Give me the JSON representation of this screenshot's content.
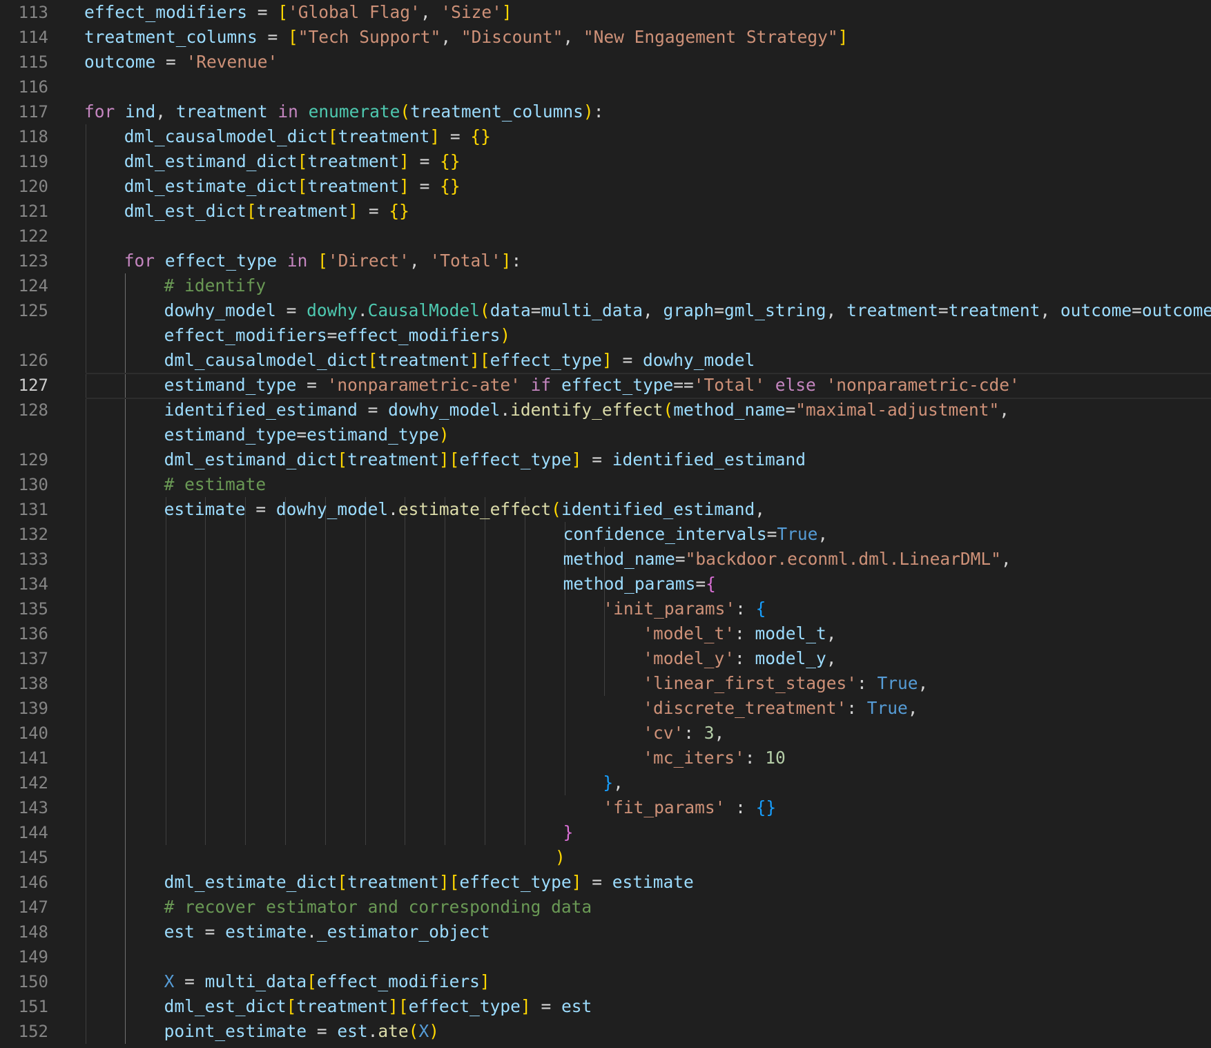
{
  "editor": {
    "language": "python",
    "theme": {
      "background": "#1f1f1f",
      "line_number": "#858585",
      "line_number_active": "#cccccc",
      "variable": "#9cdcfe",
      "string": "#ce9178",
      "keyword": "#c586c0",
      "function": "#dcdcaa",
      "class": "#4ec9b0",
      "constant": "#569cd6",
      "number": "#b5cea8",
      "comment": "#6a9955",
      "bracket_level_1": "#ffd700",
      "bracket_level_2": "#da70d6",
      "bracket_level_3": "#179fff"
    },
    "current_line": 127,
    "lines": [
      {
        "n": "113",
        "indent": 0,
        "tokens": [
          [
            "v",
            "effect_modifiers"
          ],
          [
            "o",
            " = "
          ],
          [
            "b1",
            "["
          ],
          [
            "s",
            "'Global Flag'"
          ],
          [
            "o",
            ", "
          ],
          [
            "s",
            "'Size'"
          ],
          [
            "b1",
            "]"
          ]
        ]
      },
      {
        "n": "114",
        "indent": 0,
        "tokens": [
          [
            "v",
            "treatment_columns"
          ],
          [
            "o",
            " = "
          ],
          [
            "b1",
            "["
          ],
          [
            "s",
            "\"Tech Support\""
          ],
          [
            "o",
            ", "
          ],
          [
            "s",
            "\"Discount\""
          ],
          [
            "o",
            ", "
          ],
          [
            "s",
            "\"New Engagement Strategy\""
          ],
          [
            "b1",
            "]"
          ]
        ]
      },
      {
        "n": "115",
        "indent": 0,
        "tokens": [
          [
            "v",
            "outcome"
          ],
          [
            "o",
            " = "
          ],
          [
            "s",
            "'Revenue'"
          ]
        ]
      },
      {
        "n": "116",
        "indent": 0,
        "tokens": []
      },
      {
        "n": "117",
        "indent": 0,
        "tokens": [
          [
            "k",
            "for"
          ],
          [
            "o",
            " "
          ],
          [
            "v",
            "ind"
          ],
          [
            "o",
            ", "
          ],
          [
            "v",
            "treatment"
          ],
          [
            "o",
            " "
          ],
          [
            "k",
            "in"
          ],
          [
            "o",
            " "
          ],
          [
            "c",
            "enumerate"
          ],
          [
            "b1",
            "("
          ],
          [
            "v",
            "treatment_columns"
          ],
          [
            "b1",
            ")"
          ],
          [
            "o",
            ":"
          ]
        ]
      },
      {
        "n": "118",
        "indent": 1,
        "tokens": [
          [
            "v",
            "dml_causalmodel_dict"
          ],
          [
            "b1",
            "["
          ],
          [
            "v",
            "treatment"
          ],
          [
            "b1",
            "]"
          ],
          [
            "o",
            " = "
          ],
          [
            "b1",
            "{}"
          ]
        ]
      },
      {
        "n": "119",
        "indent": 1,
        "tokens": [
          [
            "v",
            "dml_estimand_dict"
          ],
          [
            "b1",
            "["
          ],
          [
            "v",
            "treatment"
          ],
          [
            "b1",
            "]"
          ],
          [
            "o",
            " = "
          ],
          [
            "b1",
            "{}"
          ]
        ]
      },
      {
        "n": "120",
        "indent": 1,
        "tokens": [
          [
            "v",
            "dml_estimate_dict"
          ],
          [
            "b1",
            "["
          ],
          [
            "v",
            "treatment"
          ],
          [
            "b1",
            "]"
          ],
          [
            "o",
            " = "
          ],
          [
            "b1",
            "{}"
          ]
        ]
      },
      {
        "n": "121",
        "indent": 1,
        "tokens": [
          [
            "v",
            "dml_est_dict"
          ],
          [
            "b1",
            "["
          ],
          [
            "v",
            "treatment"
          ],
          [
            "b1",
            "]"
          ],
          [
            "o",
            " = "
          ],
          [
            "b1",
            "{}"
          ]
        ]
      },
      {
        "n": "122",
        "indent": 0,
        "tokens": []
      },
      {
        "n": "123",
        "indent": 1,
        "tokens": [
          [
            "k",
            "for"
          ],
          [
            "o",
            " "
          ],
          [
            "v",
            "effect_type"
          ],
          [
            "o",
            " "
          ],
          [
            "k",
            "in"
          ],
          [
            "o",
            " "
          ],
          [
            "b1",
            "["
          ],
          [
            "s",
            "'Direct'"
          ],
          [
            "o",
            ", "
          ],
          [
            "s",
            "'Total'"
          ],
          [
            "b1",
            "]"
          ],
          [
            "o",
            ":"
          ]
        ]
      },
      {
        "n": "124",
        "indent": 2,
        "tokens": [
          [
            "m",
            "# identify"
          ]
        ]
      },
      {
        "n": "125",
        "indent": 2,
        "tokens": [
          [
            "v",
            "dowhy_model"
          ],
          [
            "o",
            " = "
          ],
          [
            "c",
            "dowhy"
          ],
          [
            "o",
            "."
          ],
          [
            "c",
            "CausalModel"
          ],
          [
            "b1",
            "("
          ],
          [
            "v",
            "data"
          ],
          [
            "o",
            "="
          ],
          [
            "v",
            "multi_data"
          ],
          [
            "o",
            ", "
          ],
          [
            "v",
            "graph"
          ],
          [
            "o",
            "="
          ],
          [
            "v",
            "gml_string"
          ],
          [
            "o",
            ", "
          ],
          [
            "v",
            "treatment"
          ],
          [
            "o",
            "="
          ],
          [
            "v",
            "treatment"
          ],
          [
            "o",
            ", "
          ],
          [
            "v",
            "outcome"
          ],
          [
            "o",
            "="
          ],
          [
            "v",
            "outcome"
          ],
          [
            "o",
            ","
          ]
        ]
      },
      {
        "n": "",
        "indent": 2,
        "tokens": [
          [
            "v",
            "effect_modifiers"
          ],
          [
            "o",
            "="
          ],
          [
            "v",
            "effect_modifiers"
          ],
          [
            "b1",
            ")"
          ]
        ]
      },
      {
        "n": "126",
        "indent": 2,
        "tokens": [
          [
            "v",
            "dml_causalmodel_dict"
          ],
          [
            "b1",
            "["
          ],
          [
            "v",
            "treatment"
          ],
          [
            "b1",
            "]"
          ],
          [
            "b1",
            "["
          ],
          [
            "v",
            "effect_type"
          ],
          [
            "b1",
            "]"
          ],
          [
            "o",
            " = "
          ],
          [
            "v",
            "dowhy_model"
          ]
        ]
      },
      {
        "n": "127",
        "indent": 2,
        "tokens": [
          [
            "v",
            "estimand_type"
          ],
          [
            "o",
            " = "
          ],
          [
            "s",
            "'nonparametric-ate'"
          ],
          [
            "o",
            " "
          ],
          [
            "k",
            "if"
          ],
          [
            "o",
            " "
          ],
          [
            "v",
            "effect_type"
          ],
          [
            "o",
            "=="
          ],
          [
            "s",
            "'Total'"
          ],
          [
            "o",
            " "
          ],
          [
            "k",
            "else"
          ],
          [
            "o",
            " "
          ],
          [
            "s",
            "'nonparametric-cde'"
          ]
        ]
      },
      {
        "n": "128",
        "indent": 2,
        "tokens": [
          [
            "v",
            "identified_estimand"
          ],
          [
            "o",
            " = "
          ],
          [
            "v",
            "dowhy_model"
          ],
          [
            "o",
            "."
          ],
          [
            "f",
            "identify_effect"
          ],
          [
            "b1",
            "("
          ],
          [
            "v",
            "method_name"
          ],
          [
            "o",
            "="
          ],
          [
            "s",
            "\"maximal-adjustment\""
          ],
          [
            "o",
            ","
          ]
        ]
      },
      {
        "n": "",
        "indent": 2,
        "tokens": [
          [
            "v",
            "estimand_type"
          ],
          [
            "o",
            "="
          ],
          [
            "v",
            "estimand_type"
          ],
          [
            "b1",
            ")"
          ]
        ]
      },
      {
        "n": "129",
        "indent": 2,
        "tokens": [
          [
            "v",
            "dml_estimand_dict"
          ],
          [
            "b1",
            "["
          ],
          [
            "v",
            "treatment"
          ],
          [
            "b1",
            "]"
          ],
          [
            "b1",
            "["
          ],
          [
            "v",
            "effect_type"
          ],
          [
            "b1",
            "]"
          ],
          [
            "o",
            " = "
          ],
          [
            "v",
            "identified_estimand"
          ]
        ]
      },
      {
        "n": "130",
        "indent": 2,
        "tokens": [
          [
            "m",
            "# estimate"
          ]
        ]
      },
      {
        "n": "131",
        "indent": 2,
        "tokens": [
          [
            "v",
            "estimate"
          ],
          [
            "o",
            " = "
          ],
          [
            "v",
            "dowhy_model"
          ],
          [
            "o",
            "."
          ],
          [
            "f",
            "estimate_effect"
          ],
          [
            "b1",
            "("
          ],
          [
            "v",
            "identified_estimand"
          ],
          [
            "o",
            ","
          ]
        ]
      },
      {
        "n": "132",
        "indent": 12,
        "tokens": [
          [
            "v",
            "confidence_intervals"
          ],
          [
            "o",
            "="
          ],
          [
            "q",
            "True"
          ],
          [
            "o",
            ","
          ]
        ]
      },
      {
        "n": "133",
        "indent": 12,
        "tokens": [
          [
            "v",
            "method_name"
          ],
          [
            "o",
            "="
          ],
          [
            "s",
            "\"backdoor.econml.dml.LinearDML\""
          ],
          [
            "o",
            ","
          ]
        ]
      },
      {
        "n": "134",
        "indent": 12,
        "tokens": [
          [
            "v",
            "method_params"
          ],
          [
            "o",
            "="
          ],
          [
            "b2",
            "{"
          ]
        ]
      },
      {
        "n": "135",
        "indent": 13,
        "tokens": [
          [
            "s",
            "'init_params'"
          ],
          [
            "o",
            ": "
          ],
          [
            "b3",
            "{"
          ]
        ]
      },
      {
        "n": "136",
        "indent": 14,
        "tokens": [
          [
            "s",
            "'model_t'"
          ],
          [
            "o",
            ": "
          ],
          [
            "v",
            "model_t"
          ],
          [
            "o",
            ","
          ]
        ]
      },
      {
        "n": "137",
        "indent": 14,
        "tokens": [
          [
            "s",
            "'model_y'"
          ],
          [
            "o",
            ": "
          ],
          [
            "v",
            "model_y"
          ],
          [
            "o",
            ","
          ]
        ]
      },
      {
        "n": "138",
        "indent": 14,
        "tokens": [
          [
            "s",
            "'linear_first_stages'"
          ],
          [
            "o",
            ": "
          ],
          [
            "q",
            "True"
          ],
          [
            "o",
            ","
          ]
        ]
      },
      {
        "n": "139",
        "indent": 14,
        "tokens": [
          [
            "s",
            "'discrete_treatment'"
          ],
          [
            "o",
            ": "
          ],
          [
            "q",
            "True"
          ],
          [
            "o",
            ","
          ]
        ]
      },
      {
        "n": "140",
        "indent": 14,
        "tokens": [
          [
            "s",
            "'cv'"
          ],
          [
            "o",
            ": "
          ],
          [
            "u",
            "3"
          ],
          [
            "o",
            ","
          ]
        ]
      },
      {
        "n": "141",
        "indent": 14,
        "tokens": [
          [
            "s",
            "'mc_iters'"
          ],
          [
            "o",
            ": "
          ],
          [
            "u",
            "10"
          ]
        ]
      },
      {
        "n": "142",
        "indent": 13,
        "tokens": [
          [
            "b3",
            "}"
          ],
          [
            "o",
            ","
          ]
        ]
      },
      {
        "n": "143",
        "indent": 13,
        "tokens": [
          [
            "s",
            "'fit_params'"
          ],
          [
            "o",
            " : "
          ],
          [
            "b3",
            "{}"
          ]
        ]
      },
      {
        "n": "144",
        "indent": 12,
        "tokens": [
          [
            "b2",
            "}"
          ]
        ]
      },
      {
        "n": "145",
        "indent": 11.8,
        "tokens": [
          [
            "b1",
            ")"
          ]
        ]
      },
      {
        "n": "146",
        "indent": 2,
        "tokens": [
          [
            "v",
            "dml_estimate_dict"
          ],
          [
            "b1",
            "["
          ],
          [
            "v",
            "treatment"
          ],
          [
            "b1",
            "]"
          ],
          [
            "b1",
            "["
          ],
          [
            "v",
            "effect_type"
          ],
          [
            "b1",
            "]"
          ],
          [
            "o",
            " = "
          ],
          [
            "v",
            "estimate"
          ]
        ]
      },
      {
        "n": "147",
        "indent": 2,
        "tokens": [
          [
            "m",
            "# recover estimator and corresponding data"
          ]
        ]
      },
      {
        "n": "148",
        "indent": 2,
        "tokens": [
          [
            "v",
            "est"
          ],
          [
            "o",
            " = "
          ],
          [
            "v",
            "estimate"
          ],
          [
            "o",
            "."
          ],
          [
            "v",
            "_estimator_object"
          ]
        ]
      },
      {
        "n": "149",
        "indent": 0,
        "tokens": []
      },
      {
        "n": "150",
        "indent": 2,
        "tokens": [
          [
            "q",
            "X"
          ],
          [
            "o",
            " = "
          ],
          [
            "v",
            "multi_data"
          ],
          [
            "b1",
            "["
          ],
          [
            "v",
            "effect_modifiers"
          ],
          [
            "b1",
            "]"
          ]
        ]
      },
      {
        "n": "151",
        "indent": 2,
        "tokens": [
          [
            "v",
            "dml_est_dict"
          ],
          [
            "b1",
            "["
          ],
          [
            "v",
            "treatment"
          ],
          [
            "b1",
            "]"
          ],
          [
            "b1",
            "["
          ],
          [
            "v",
            "effect_type"
          ],
          [
            "b1",
            "]"
          ],
          [
            "o",
            " = "
          ],
          [
            "v",
            "est"
          ]
        ]
      },
      {
        "n": "152",
        "indent": 2,
        "tokens": [
          [
            "v",
            "point_estimate"
          ],
          [
            "o",
            " = "
          ],
          [
            "v",
            "est"
          ],
          [
            "o",
            "."
          ],
          [
            "f",
            "ate"
          ],
          [
            "b1",
            "("
          ],
          [
            "q",
            "X"
          ],
          [
            "b1",
            ")"
          ]
        ]
      }
    ]
  }
}
